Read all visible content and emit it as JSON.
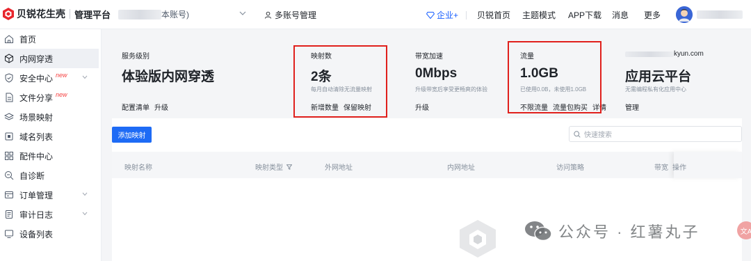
{
  "brand": {
    "name": "贝锐花生壳",
    "sub": "管理平台"
  },
  "account": {
    "label": "本账号)"
  },
  "multi_account": {
    "label": "多账号管理"
  },
  "nav": {
    "enterprise": "企业+",
    "items": [
      "贝锐首页",
      "主题模式",
      "APP下载",
      "消息",
      "更多"
    ]
  },
  "sidebar": {
    "items": [
      {
        "label": "首页",
        "icon": "home-icon"
      },
      {
        "label": "内网穿透",
        "icon": "cube-icon"
      },
      {
        "label": "安全中心",
        "icon": "shield-icon",
        "badge": "new"
      },
      {
        "label": "文件分享",
        "icon": "file-icon",
        "badge": "new"
      },
      {
        "label": "场景映射",
        "icon": "layers-icon"
      },
      {
        "label": "域名列表",
        "icon": "domain-icon"
      },
      {
        "label": "配件中心",
        "icon": "grid-icon"
      },
      {
        "label": "自诊断",
        "icon": "diagnose-icon"
      },
      {
        "label": "订单管理",
        "icon": "order-icon"
      },
      {
        "label": "审计日志",
        "icon": "log-icon"
      },
      {
        "label": "设备列表",
        "icon": "device-icon"
      }
    ]
  },
  "summary": {
    "service": {
      "title": "服务级别",
      "value": "体验版内网穿透",
      "links": [
        "配置清单",
        "升级"
      ]
    },
    "mappings": {
      "title": "映射数",
      "value": "2条",
      "desc": "每月自动清除无流量映射",
      "links": [
        "新增数量",
        "保留映射"
      ]
    },
    "bandwidth": {
      "title": "带宽加速",
      "value": "0Mbps",
      "desc": "升级带宽后享受更畅爽的体验",
      "links": [
        "升级"
      ]
    },
    "traffic": {
      "title": "流量",
      "value": "1.0GB",
      "desc": "已使用0.0B，未使用1.0GB",
      "links": [
        "不限流量",
        "流量包购买",
        "详情"
      ]
    },
    "cloud": {
      "email_suffix": "kyun.com",
      "value": "应用云平台",
      "desc": "无需编程私有化应用中心",
      "links": [
        "管理"
      ]
    }
  },
  "toolbar": {
    "add_label": "添加映射",
    "search_placeholder": "快速搜索"
  },
  "table": {
    "columns": [
      "映射名称",
      "映射类型",
      "外网地址",
      "内网地址",
      "访问策略",
      "带宽",
      "操作"
    ]
  },
  "watermark": {
    "text": "公众号 · 红薯丸子"
  },
  "fab": {
    "label": "文A"
  },
  "colors": {
    "accent": "#165dff",
    "highlight": "#e0201c",
    "button": "#1e6bf5"
  }
}
